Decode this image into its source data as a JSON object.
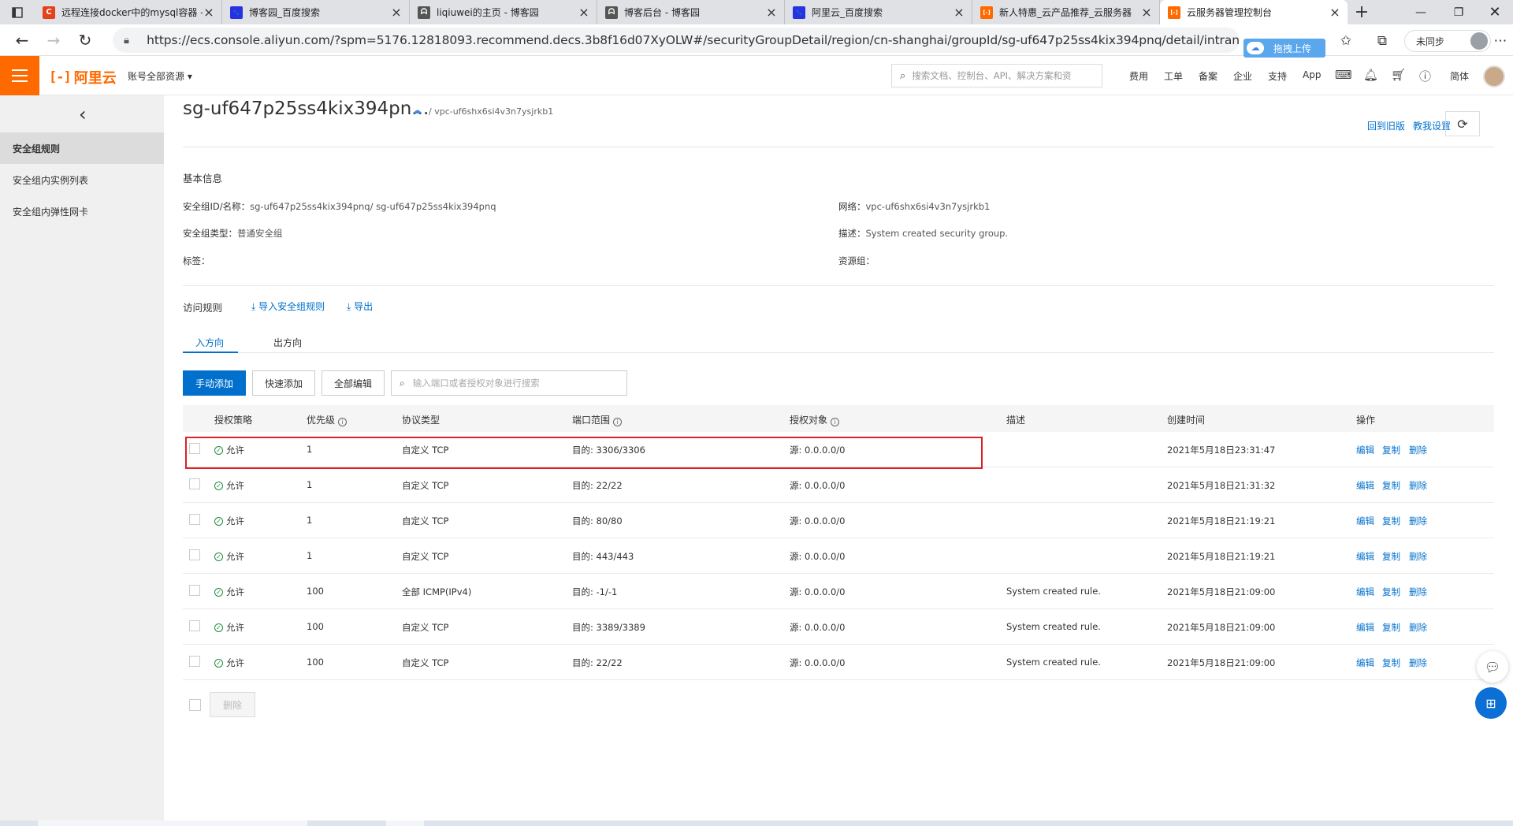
{
  "browser": {
    "tabs": [
      {
        "title": "远程连接docker中的mysql容器 -",
        "icon": "csdn-icon",
        "icon_color": "#e3421c",
        "icon_text": "C"
      },
      {
        "title": "博客园_百度搜索",
        "icon": "baidu-icon",
        "icon_color": "#2932e1",
        "icon_text": "🐾"
      },
      {
        "title": "liqiuwei的主页 - 博客园",
        "icon": "cnblogs-icon",
        "icon_color": "#555555",
        "icon_text": "ᗣ"
      },
      {
        "title": "博客后台 - 博客园",
        "icon": "cnblogs-icon",
        "icon_color": "#555555",
        "icon_text": "ᗣ"
      },
      {
        "title": "阿里云_百度搜索",
        "icon": "baidu-icon",
        "icon_color": "#2932e1",
        "icon_text": "🐾"
      },
      {
        "title": "新人特惠_云产品推荐_云服务器",
        "icon": "aliyun-icon",
        "icon_color": "#ff6a00",
        "icon_text": "[-]"
      },
      {
        "title": "云服务器管理控制台",
        "icon": "aliyun-icon",
        "icon_color": "#ff6a00",
        "icon_text": "[-]"
      }
    ],
    "url": "https://ecs.console.aliyun.com/?spm=5176.12818093.recommend.decs.3b8f16d07XyOLW#/securityGroupDetail/region/cn-shanghai/groupId/sg-uf647p25ss4kix394pnq/detail/intranetIngress",
    "upload_pill": "拖拽上传",
    "sync_label": "未同步"
  },
  "header": {
    "logo_text": "阿里云",
    "account": "账号全部资源 ▾",
    "search_placeholder": "搜索文档、控制台、API、解决方案和资",
    "nav": [
      "费用",
      "工单",
      "备案",
      "企业",
      "支持",
      "App"
    ],
    "lang": "简体"
  },
  "sidebar": {
    "items": [
      {
        "label": "安全组规则",
        "active": true
      },
      {
        "label": "安全组内实例列表",
        "active": false
      },
      {
        "label": "安全组内弹性网卡",
        "active": false
      }
    ]
  },
  "page": {
    "title": "sg-uf647p25ss4kix394pn...",
    "vpc_crumb": "/ vpc-uf6shx6si4v3n7ysjrkb1",
    "link_old": "回到旧版",
    "link_settings": "教我设置",
    "basic_title": "基本信息",
    "info": {
      "id_label": "安全组ID/名称：",
      "id_value": "sg-uf647p25ss4kix394pnq/ sg-uf647p25ss4kix394pnq",
      "type_label": "安全组类型：",
      "type_value": "普通安全组",
      "tag_label": "标签：",
      "net_label": "网络：",
      "net_value": "vpc-uf6shx6si4v3n7ysjrkb1",
      "desc_label": "描述：",
      "desc_value": "System created security group.",
      "rg_label": "资源组："
    },
    "access_rules": "访问规则",
    "import_label": "导入安全组规则",
    "export_label": "导出",
    "tab_in": "入方向",
    "tab_out": "出方向",
    "btn_manual": "手动添加",
    "btn_quick": "快速添加",
    "btn_edit_all": "全部编辑",
    "rule_search_placeholder": "输入端口或者授权对象进行搜索",
    "btn_delete": "删除"
  },
  "table": {
    "columns": [
      "授权策略",
      "优先级",
      "协议类型",
      "端口范围",
      "授权对象",
      "描述",
      "创建时间",
      "操作"
    ],
    "actions": [
      "编辑",
      "复制",
      "删除"
    ],
    "rows": [
      {
        "policy": "允许",
        "priority": "1",
        "protocol": "自定义 TCP",
        "port": "目的: 3306/3306",
        "source": "源: 0.0.0.0/0",
        "desc": "",
        "created": "2021年5月18日23:31:47"
      },
      {
        "policy": "允许",
        "priority": "1",
        "protocol": "自定义 TCP",
        "port": "目的: 22/22",
        "source": "源: 0.0.0.0/0",
        "desc": "",
        "created": "2021年5月18日21:31:32"
      },
      {
        "policy": "允许",
        "priority": "1",
        "protocol": "自定义 TCP",
        "port": "目的: 80/80",
        "source": "源: 0.0.0.0/0",
        "desc": "",
        "created": "2021年5月18日21:19:21"
      },
      {
        "policy": "允许",
        "priority": "1",
        "protocol": "自定义 TCP",
        "port": "目的: 443/443",
        "source": "源: 0.0.0.0/0",
        "desc": "",
        "created": "2021年5月18日21:19:21"
      },
      {
        "policy": "允许",
        "priority": "100",
        "protocol": "全部 ICMP(IPv4)",
        "port": "目的: -1/-1",
        "source": "源: 0.0.0.0/0",
        "desc": "System created rule.",
        "created": "2021年5月18日21:09:00"
      },
      {
        "policy": "允许",
        "priority": "100",
        "protocol": "自定义 TCP",
        "port": "目的: 3389/3389",
        "source": "源: 0.0.0.0/0",
        "desc": "System created rule.",
        "created": "2021年5月18日21:09:00"
      },
      {
        "policy": "允许",
        "priority": "100",
        "protocol": "自定义 TCP",
        "port": "目的: 22/22",
        "source": "源: 0.0.0.0/0",
        "desc": "System created rule.",
        "created": "2021年5月18日21:09:00"
      }
    ]
  },
  "colors": {
    "accent": "#ff6a00",
    "link": "#0070cc",
    "highlight": "#e02020"
  }
}
